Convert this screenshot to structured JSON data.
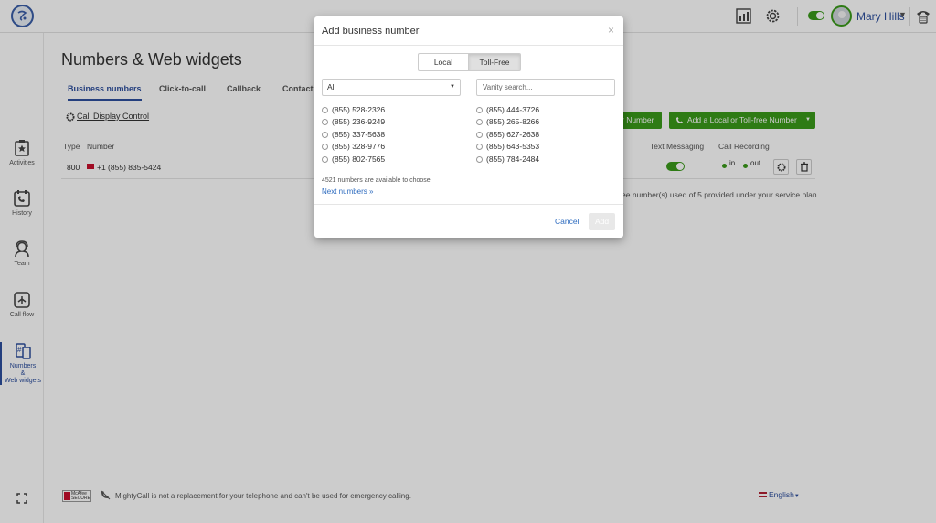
{
  "topbar": {
    "user_name": "Mary Hills",
    "icons": [
      "dashboard-chart-icon",
      "settings-gear-icon",
      "status-toggle",
      "phone-icon"
    ]
  },
  "sidebar": {
    "items": [
      {
        "label": "Activities",
        "icon": "star-clipboard-icon"
      },
      {
        "label": "History",
        "icon": "calendar-phone-icon"
      },
      {
        "label": "Team",
        "icon": "headset-user-icon"
      },
      {
        "label": "Call flow",
        "icon": "call-flow-icon"
      },
      {
        "label_lines": [
          "Numbers",
          "&",
          "Web widgets"
        ],
        "icon": "hash-devices-icon",
        "active": true
      }
    ]
  },
  "main": {
    "title": "Numbers & Web widgets",
    "tabs": [
      {
        "label": "Business numbers",
        "active": true
      },
      {
        "label": "Click-to-call"
      },
      {
        "label": "Callback"
      },
      {
        "label": "Contact"
      }
    ],
    "call_display_control": "Call Display Control",
    "buttons": {
      "partial_number": "r Number",
      "add_number": "Add a Local or Toll-free Number"
    },
    "table": {
      "headers": [
        "Type",
        "Number",
        "Text Messaging",
        "Call Recording"
      ],
      "rows": [
        {
          "type": "800",
          "number": "+1 (855) 835-5424",
          "rec_in": "in",
          "rec_out": "out"
        }
      ]
    },
    "plan_text": "ee number(s) used of 5 provided under your service plan",
    "footer": {
      "notice": "MightyCall is not a replacement for your telephone and can't be used for emergency calling.",
      "badge": "McAfee SECURE",
      "language": "English"
    }
  },
  "modal": {
    "title": "Add business number",
    "close": "×",
    "segments": {
      "local": "Local",
      "toll_free": "Toll-Free",
      "selected": "Toll-Free"
    },
    "filter_select": "All",
    "vanity_placeholder": "Vanity search...",
    "numbers_left": [
      "(855) 528-2326",
      "(855) 236-9249",
      "(855) 337-5638",
      "(855) 328-9776",
      "(855) 802-7565"
    ],
    "numbers_right": [
      "(855) 444-3726",
      "(855) 265-8266",
      "(855) 627-2638",
      "(855) 643-5353",
      "(855) 784-2484"
    ],
    "available": "4521 numbers are available to choose",
    "next": "Next numbers »",
    "cancel": "Cancel",
    "add": "Add"
  },
  "colors": {
    "accent_blue": "#2d4f9e",
    "green": "#3a9a1a",
    "link": "#2d6bbf"
  }
}
